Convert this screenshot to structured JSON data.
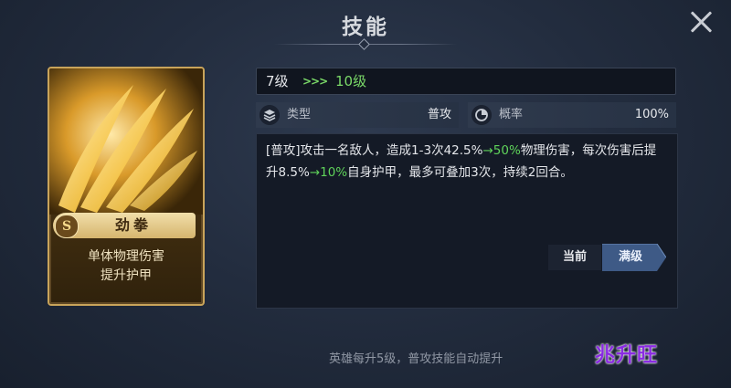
{
  "window": {
    "title": "技能"
  },
  "skill": {
    "grade": "S",
    "name": "劲拳",
    "summary_line1": "单体物理伤害",
    "summary_line2": "提升护甲",
    "level_from": "7级",
    "level_arrows": ">>>",
    "level_to": "10级",
    "type_label": "类型",
    "type_value": "普攻",
    "rate_label": "概率",
    "rate_value": "100%",
    "description": {
      "part1": "[普攻]攻击一名敌人，造成1-3次42.5%",
      "up1": "→50%",
      "part2": "物理伤害，每次伤害后提升8.5%",
      "up2": "→10%",
      "part3": "自身护甲，最多可叠加3次，持续2回合。"
    }
  },
  "buttons": {
    "current": "当前",
    "max": "满级"
  },
  "footer": "英雄每升5级，普攻技能自动提升",
  "watermark": "兆升旺",
  "colors": {
    "upgrade_green": "#5fd35a",
    "card_gold": "#c9a45a",
    "accent_blue": "#3e5a86"
  }
}
